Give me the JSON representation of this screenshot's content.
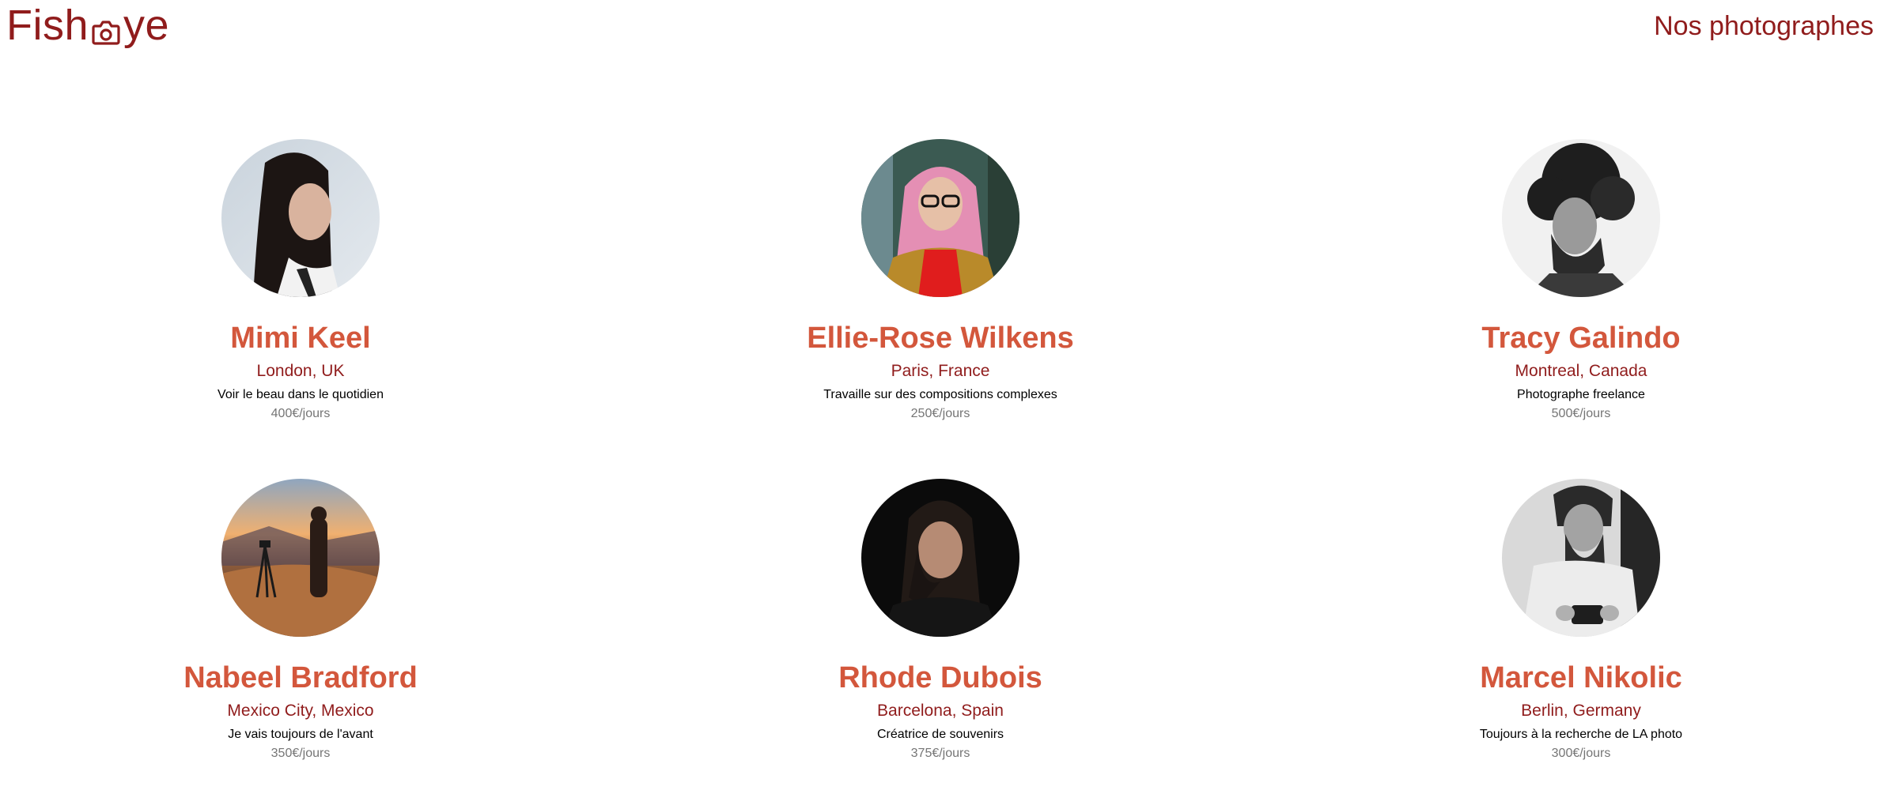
{
  "header": {
    "logo_text_left": "Fish",
    "logo_text_right": "ye",
    "logo_icon": "camera-icon",
    "heading": "Nos photographes"
  },
  "colors": {
    "brand": "#901c1c",
    "accent": "#d3573c",
    "price": "#757575"
  },
  "photographers": [
    {
      "name": "Mimi Keel",
      "location": "London, UK",
      "tagline": "Voir le beau dans le quotidien",
      "price": "400€/jours",
      "portrait": "woman-long-dark-hair-portrait"
    },
    {
      "name": "Ellie-Rose Wilkens",
      "location": "Paris, France",
      "tagline": "Travaille sur des compositions complexes",
      "price": "250€/jours",
      "portrait": "woman-pink-hair-glasses-portrait"
    },
    {
      "name": "Tracy Galindo",
      "location": "Montreal, Canada",
      "tagline": "Photographe freelance",
      "price": "500€/jours",
      "portrait": "man-curly-hair-beard-bw-portrait"
    },
    {
      "name": "Nabeel Bradford",
      "location": "Mexico City, Mexico",
      "tagline": "Je vais toujours de l'avant",
      "price": "350€/jours",
      "portrait": "photographer-sunset-mountain"
    },
    {
      "name": "Rhode Dubois",
      "location": "Barcelona, Spain",
      "tagline": "Créatrice de souvenirs",
      "price": "375€/jours",
      "portrait": "woman-dark-background-portrait"
    },
    {
      "name": "Marcel Nikolic",
      "location": "Berlin, Germany",
      "tagline": "Toujours à la recherche de LA photo",
      "price": "300€/jours",
      "portrait": "man-beard-camera-bw-portrait"
    }
  ]
}
